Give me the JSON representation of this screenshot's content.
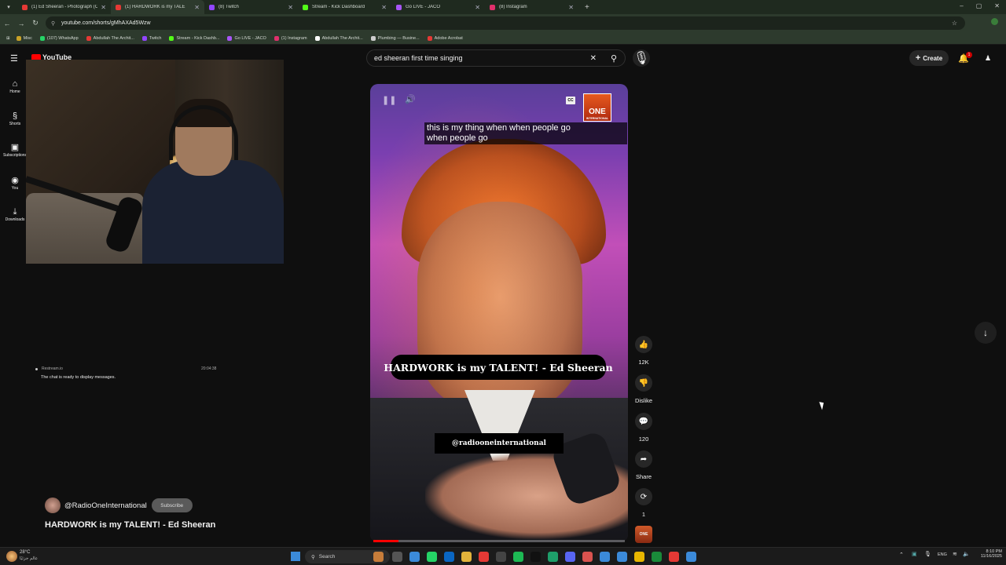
{
  "browser": {
    "tabs": [
      {
        "title": "(1) Ed Sheeran - Photograph (O",
        "color": "#e53935",
        "active": false
      },
      {
        "title": "(1) HARDWORK is my TALE",
        "color": "#e53935",
        "active": true
      },
      {
        "title": "(8) Twitch",
        "color": "#9146ff",
        "active": false
      },
      {
        "title": "Stream - Kick Dashboard",
        "color": "#53fc18",
        "active": false
      },
      {
        "title": "Go LIVE - JACO",
        "color": "#a855f7",
        "active": false
      },
      {
        "title": "(8) Instagram",
        "color": "#e1306c",
        "active": false
      }
    ],
    "url": "youtube.com/shorts/gMhAXAd5Wzw",
    "bookmarks": [
      {
        "label": "Misc",
        "color": "#c9a227"
      },
      {
        "label": "(107) WhatsApp",
        "color": "#25d366"
      },
      {
        "label": "Abdullah The Archit...",
        "color": "#e53935"
      },
      {
        "label": "Twitch",
        "color": "#9146ff"
      },
      {
        "label": "Stream - Kick Dashb...",
        "color": "#53fc18"
      },
      {
        "label": "Go LIVE - JACO",
        "color": "#a855f7"
      },
      {
        "label": "(1) Instagram",
        "color": "#e1306c"
      },
      {
        "label": "Abdullah The Archit...",
        "color": "#ffffff"
      },
      {
        "label": "Plumbing — Busine...",
        "color": "#cccccc"
      },
      {
        "label": "Adobe Acrobat",
        "color": "#e53935"
      }
    ]
  },
  "youtube": {
    "logo_text": "YouTube",
    "search_value": "ed  sheeran first time singing",
    "create_label": "Create",
    "notification_count": "1",
    "sidebar": [
      {
        "label": "Home",
        "icon": "⌂"
      },
      {
        "label": "Shorts",
        "icon": "§"
      },
      {
        "label": "Subscriptions",
        "icon": "▣"
      },
      {
        "label": "You",
        "icon": "◉"
      },
      {
        "label": "Downloads",
        "icon": "⤓"
      }
    ]
  },
  "chat": {
    "source": "Restream.io",
    "time": "20:04:38",
    "message": "The chat is ready to display messages."
  },
  "video": {
    "caption_lines": [
      "this is my thing when when people go",
      "when people go"
    ],
    "title_overlay": "HARDWORK is my TALENT! - Ed Sheeran",
    "handle_overlay": "@radiooneinternational",
    "logo_text": "ONE",
    "logo_sub": "INTERNATIONAL",
    "cc_label": "CC",
    "progress": 0.1
  },
  "actions": [
    {
      "name": "like",
      "icon": "👍",
      "label": "12K"
    },
    {
      "name": "dislike",
      "icon": "👎",
      "label": "Dislike"
    },
    {
      "name": "comments",
      "icon": "💬",
      "label": "120"
    },
    {
      "name": "share",
      "icon": "➦",
      "label": "Share"
    },
    {
      "name": "remix",
      "icon": "⟳",
      "label": "1"
    }
  ],
  "channel": {
    "name": "@RadioOneInternational",
    "subscribe_label": "Subscribe",
    "video_title": "HARDWORK is my TALENT! - Ed Sheeran"
  },
  "taskbar": {
    "weather_temp": "28°C",
    "weather_desc": "عالم جزئيًا",
    "search_placeholder": "Search",
    "lang": "ENG",
    "time": "8:10 PM",
    "date": "11/16/2025"
  }
}
